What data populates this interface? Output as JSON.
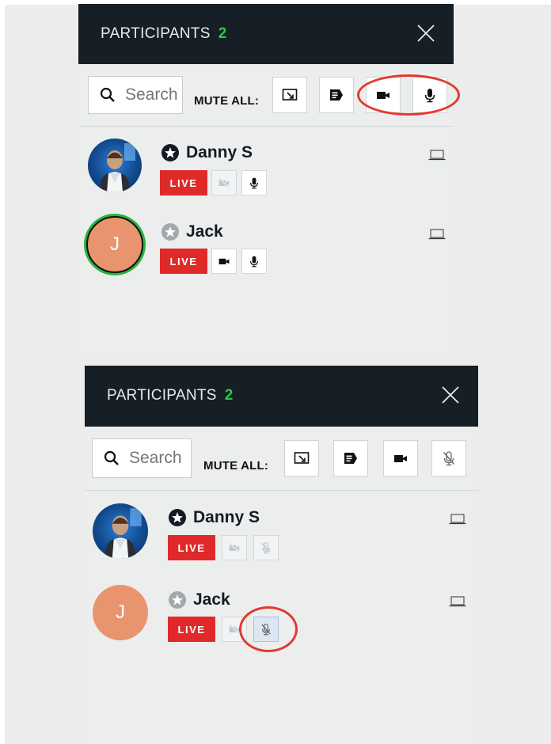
{
  "panels": [
    {
      "header": {
        "title": "PARTICIPANTS",
        "count": "2"
      },
      "search": {
        "placeholder": "Search"
      },
      "mute_all_label": "MUTE ALL:",
      "participants": [
        {
          "name": "Danny S",
          "status": "LIVE"
        },
        {
          "name": "Jack",
          "initial": "J",
          "status": "LIVE"
        }
      ]
    },
    {
      "header": {
        "title": "PARTICIPANTS",
        "count": "2"
      },
      "search": {
        "placeholder": "Search"
      },
      "mute_all_label": "MUTE ALL:",
      "participants": [
        {
          "name": "Danny S",
          "status": "LIVE"
        },
        {
          "name": "Jack",
          "initial": "J",
          "status": "LIVE"
        }
      ]
    }
  ],
  "colors": {
    "header_bg": "#161e26",
    "count_green": "#36c24a",
    "live_red": "#e02a2a",
    "highlight_red": "#e23a2e"
  }
}
